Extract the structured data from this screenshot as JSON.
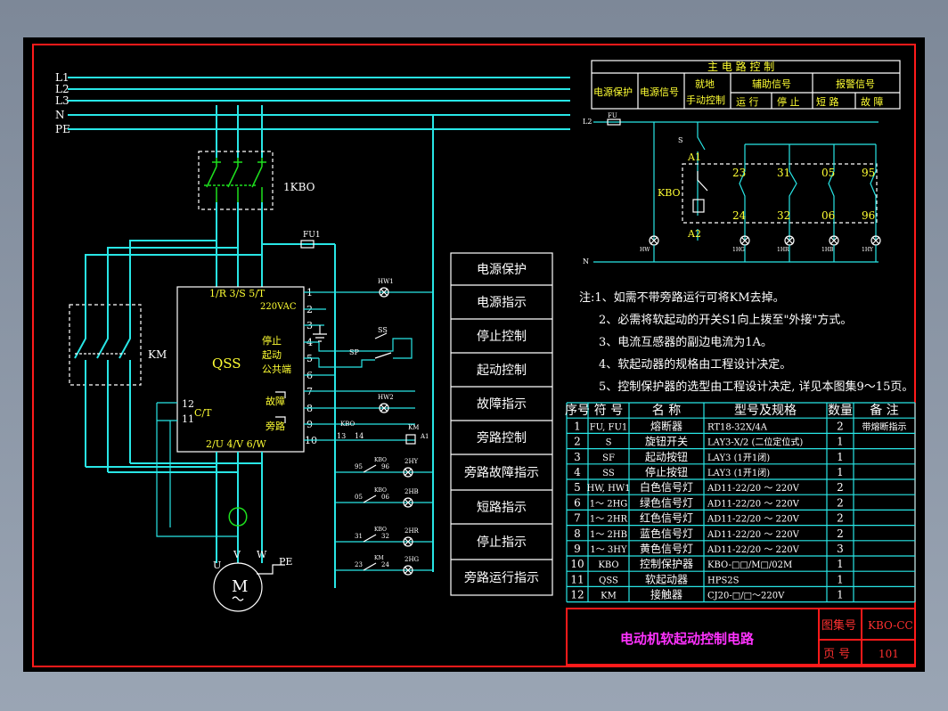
{
  "buses": [
    {
      "label": "L1"
    },
    {
      "label": "L2"
    },
    {
      "label": "L3"
    },
    {
      "label": "N"
    },
    {
      "label": "PE"
    }
  ],
  "main": {
    "breaker_label": "1KBO",
    "contactor_label": "KM",
    "fuse_label": "FU1",
    "qss": {
      "name": "QSS",
      "t1": "1/R 3/S 5/T",
      "t2": "2/U 4/V 6/W",
      "v": "220VAC",
      "ct": "C/T",
      "stop": "停止",
      "start": "起动",
      "common": "公共端",
      "fault": "故障",
      "bypass": "旁路"
    },
    "motor": {
      "symbol": "M",
      "phases": [
        "U",
        "V",
        "W"
      ],
      "pe": "PE"
    },
    "terminals": [
      "1",
      "2",
      "3",
      "4",
      "5",
      "6",
      "7",
      "8",
      "9",
      "10",
      "12",
      "11"
    ],
    "sp": "SP",
    "ss": "SS",
    "hw1": "HW1",
    "hw2": "HW2",
    "kbo": "KBO",
    "km": "KM",
    "a1": "A1",
    "n13": "13",
    "n14": "14",
    "ctrl_rows": [
      {
        "c1": "95",
        "c2": "96",
        "lamp": "2HY"
      },
      {
        "c1": "05",
        "c2": "06",
        "lamp": "2HB"
      },
      {
        "c1": "31",
        "c2": "32",
        "lamp": "2HR"
      },
      {
        "c1": "23",
        "c2": "24",
        "lamp": "2HG"
      }
    ],
    "ctrl_tags": [
      "KBO",
      "KBO",
      "KBO",
      "KM"
    ]
  },
  "function_labels": [
    "电源保护",
    "电源指示",
    "停止控制",
    "起动控制",
    "故障指示",
    "旁路控制",
    "旁路故障指示",
    "短路指示",
    "停止指示",
    "旁路运行指示"
  ],
  "header_table": {
    "title": "主 电 路 控 制",
    "c1": "电源保护",
    "c2": "电源信号",
    "c3a": "就地",
    "c3b": "手动控制",
    "c4": "辅助信号",
    "c4a": "运 行",
    "c4b": "停 止",
    "c5": "报警信号",
    "c5a": "短 路",
    "c5b": "故 障"
  },
  "control": {
    "l2": "L2",
    "fu": "FU",
    "n": "N",
    "s": "S",
    "a1": "A1",
    "a2": "A2",
    "kbo": "KBO",
    "contacts": [
      "23",
      "31",
      "05",
      "95"
    ],
    "contacts_bottom": [
      "24",
      "32",
      "06",
      "96"
    ],
    "lamps": [
      "HW",
      "1HG",
      "1HR",
      "1HB",
      "1HY"
    ]
  },
  "notes": [
    "注:1、如需不带旁路运行可将KM去掉。",
    "2、必需将软起动的开关S1向上拨至\"外接\"方式。",
    "3、电流互感器的副边电流为1A。",
    "4、软起动器的规格由工程设计决定。",
    "5、控制保护器的选型由工程设计决定, 详见本图集9～15页。"
  ],
  "bom": {
    "headers": [
      "序号",
      "符 号",
      "名 称",
      "型号及规格",
      "数量",
      "备 注"
    ],
    "rows": [
      [
        "1",
        "FU, FU1",
        "熔断器",
        "RT18-32X/4A",
        "2",
        "带熔断指示"
      ],
      [
        "2",
        "S",
        "旋钮开关",
        "LAY3-X/2 (二位定位式)",
        "1",
        ""
      ],
      [
        "3",
        "SF",
        "起动按钮",
        "LAY3 (1开1闭)",
        "1",
        ""
      ],
      [
        "4",
        "SS",
        "停止按钮",
        "LAY3 (1开1闭)",
        "1",
        ""
      ],
      [
        "5",
        "HW, HW1",
        "白色信号灯",
        "AD11-22/20 ～ 220V",
        "2",
        ""
      ],
      [
        "6",
        "1～ 2HG",
        "绿色信号灯",
        "AD11-22/20 ～ 220V",
        "2",
        ""
      ],
      [
        "7",
        "1～ 2HR",
        "红色信号灯",
        "AD11-22/20 ～ 220V",
        "2",
        ""
      ],
      [
        "8",
        "1～ 2HB",
        "蓝色信号灯",
        "AD11-22/20 ～ 220V",
        "2",
        ""
      ],
      [
        "9",
        "1～ 3HY",
        "黄色信号灯",
        "AD11-22/20 ～ 220V",
        "3",
        ""
      ],
      [
        "10",
        "KBO",
        "控制保护器",
        "KBO-□□/M□/02M",
        "1",
        ""
      ],
      [
        "11",
        "QSS",
        "软起动器",
        "HPS2S",
        "1",
        ""
      ],
      [
        "12",
        "KM",
        "接触器",
        "CJ20-□/□～220V",
        "1",
        ""
      ]
    ]
  },
  "title_block": {
    "title": "电动机软起动控制电路",
    "atlas_label": "图集号",
    "atlas_value": "KBO-CC",
    "page_label": "页 号",
    "page_value": "101"
  }
}
